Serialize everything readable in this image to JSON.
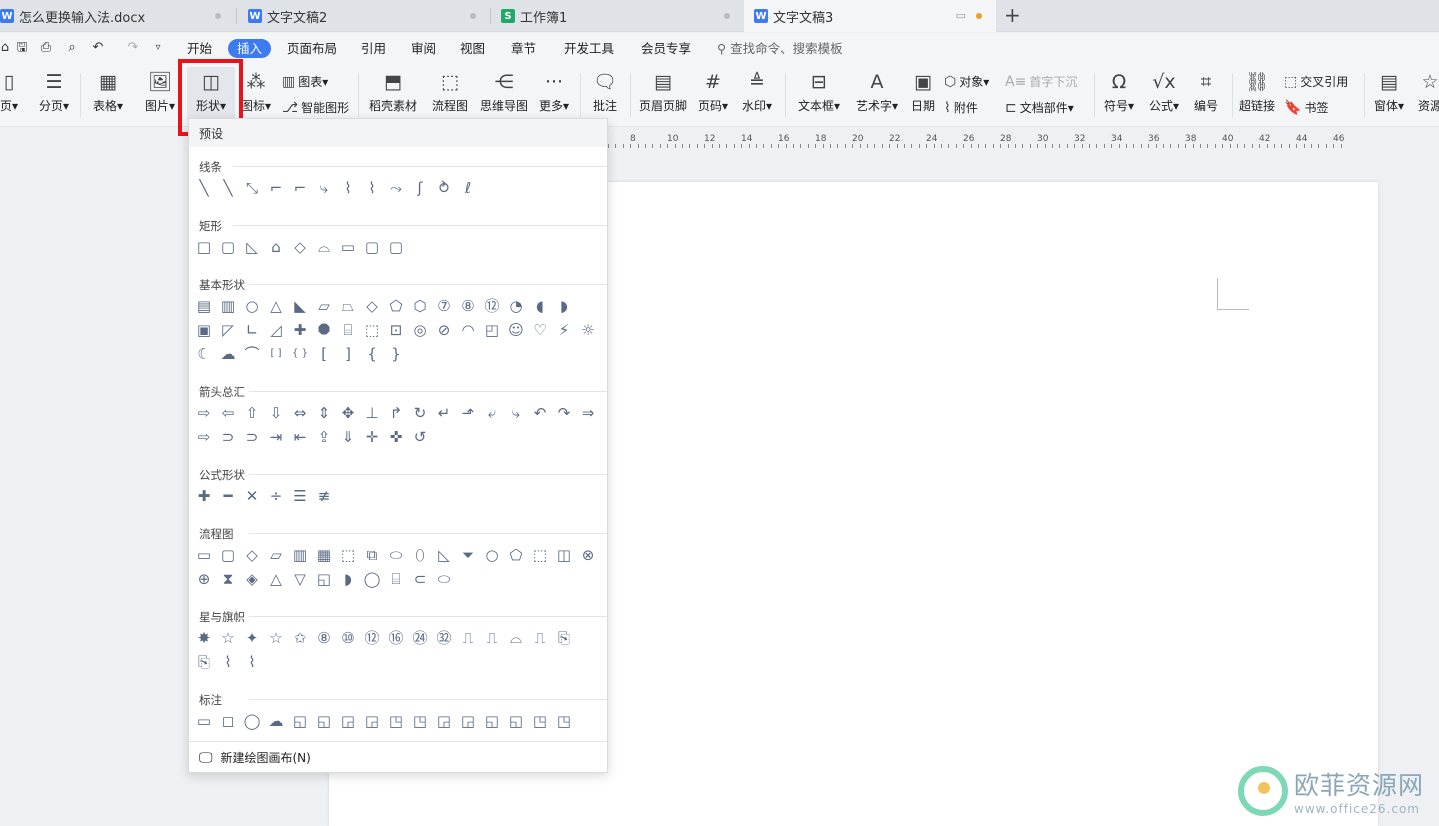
{
  "tabs": [
    {
      "label": "怎么更换输入法.docx",
      "icon": "W",
      "color": "#3c7cf0"
    },
    {
      "label": "文字文稿2",
      "icon": "W",
      "color": "#3c7cf0"
    },
    {
      "label": "工作簿1",
      "icon": "S",
      "color": "#20a868"
    },
    {
      "label": "文字文稿3",
      "icon": "W",
      "color": "#3c7cf0"
    }
  ],
  "new_tab": "+",
  "menu": [
    "开始",
    "插入",
    "页面布局",
    "引用",
    "审阅",
    "视图",
    "章节",
    "开发工具",
    "会员专享"
  ],
  "search_placeholder": "查找命令、搜索模板",
  "ribbon": {
    "page": "页",
    "break": "分页",
    "table": "表格",
    "picture": "图片",
    "shape": "形状",
    "icon": "图标",
    "chart": "图表",
    "smart": "智能图形",
    "material": "稻壳素材",
    "flow": "流程图",
    "mind": "思维导图",
    "more": "更多",
    "comment": "批注",
    "header": "页眉页脚",
    "pagenum": "页码",
    "watermark": "水印",
    "textbox": "文本框",
    "wordart": "艺术字",
    "date": "日期",
    "object": "对象",
    "dropcap": "首字下沉",
    "attach": "附件",
    "docpart": "文档部件",
    "symbol": "符号",
    "formula": "公式",
    "number": "编号",
    "link": "超链接",
    "crossref": "交叉引用",
    "bookmark": "书签",
    "window": "窗体",
    "resource": "资源"
  },
  "ruler_numbers": [
    "8",
    "10",
    "12",
    "14",
    "16",
    "18",
    "20",
    "22",
    "24",
    "26",
    "28",
    "30",
    "32",
    "34",
    "36",
    "38",
    "40",
    "42",
    "44",
    "46"
  ],
  "panel": {
    "preset": "预设",
    "sections": [
      "线条",
      "矩形",
      "基本形状",
      "箭头总汇",
      "公式形状",
      "流程图",
      "星与旗帜",
      "标注"
    ],
    "new_canvas": "新建绘图画布(N)"
  },
  "watermark": {
    "title": "欧菲资源网",
    "url": "www.office26.com"
  }
}
